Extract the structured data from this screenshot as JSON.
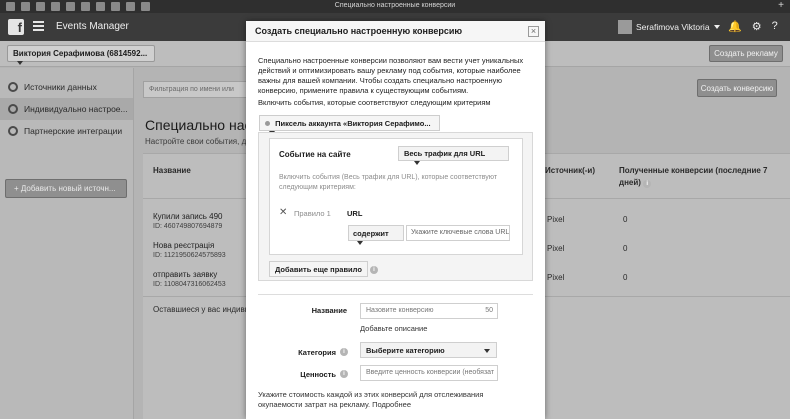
{
  "window": {
    "title": "Специально настроенные конверсии"
  },
  "topbar": {
    "logo": "f",
    "app_title": "Events Manager",
    "user_name": "Serafimova Viktoria"
  },
  "account": {
    "selector": "Виктория Серафимова (6814592...",
    "create_ad": "Создать рекламу"
  },
  "sidebar": {
    "items": [
      {
        "label": "Источники данных"
      },
      {
        "label": "Индивидуально настрое..."
      },
      {
        "label": "Партнерские интеграции"
      }
    ],
    "add_source": "+ Добавить новый источн..."
  },
  "main": {
    "search_placeholder": "Фильтрация по имени или",
    "create_conversion": "Создать конверсию",
    "title": "Специально наст",
    "subtitle": "Настройте свои события, д",
    "columns": {
      "name": "Название",
      "sources": "Источник(-и)",
      "received": "Полученные конверсии (последние 7 дней)"
    },
    "rows": [
      {
        "name": "Купили запись 490",
        "id": "ID: 460749807694879",
        "source": "Pixel",
        "count": "0"
      },
      {
        "name": "Нова реєстрація",
        "id": "ID: 1121950624575893",
        "source": "Pixel",
        "count": "0"
      },
      {
        "name": "отправить заявку",
        "id": "ID: 1108047316062453",
        "source": "Pixel",
        "count": "0"
      }
    ],
    "footer_text": "Оставшиеся у вас индивиду"
  },
  "modal": {
    "title": "Создать специально настроенную конверсию",
    "intro": "Специально настроенные конверсии позволяют вам вести учет уникальных действий и оптимизировать вашу рекламу под события, которые наиболее важны для вашей компании. Чтобы создать специально настроенную конверсию, примените правила к существующим событиям.",
    "criteria_label": "Включить события, которые соответствуют следующим критериям",
    "pixel_select": "Пиксель аккаунта «Виктория Серафимо...",
    "event_label": "Событие на сайте",
    "traffic_select": "Весь трафик для URL",
    "include_text": "Включить события (Весь трафик для URL), которые соответствуют следующим критериям:",
    "rule_label": "Правило 1",
    "url_label": "URL",
    "contains_select": "содержит",
    "keywords_placeholder": "Укажите ключевые слова URL",
    "add_rule": "Добавить еще правило",
    "name_label": "Название",
    "name_placeholder": "Назовите конверсию",
    "name_counter": "50",
    "add_description": "Добавьте описание",
    "category_label": "Категория",
    "category_select": "Выберите категорию",
    "value_label": "Ценность",
    "value_placeholder": "Введите ценность конверсии (необязат",
    "footer_note": "Укажите стоимость каждой из этих конверсий для отслеживания окупаемости затрат на рекламу. Подробнее"
  }
}
